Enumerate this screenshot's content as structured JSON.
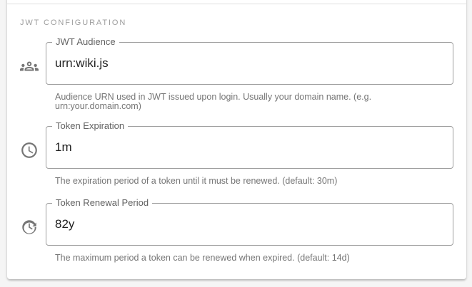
{
  "section": {
    "title": "JWT CONFIGURATION"
  },
  "fields": [
    {
      "icon": "people-icon",
      "label": "JWT Audience",
      "value": "urn:wiki.js",
      "hint": "Audience URN used in JWT issued upon login. Usually your domain name. (e.g. urn:your.domain.com)"
    },
    {
      "icon": "clock-icon",
      "label": "Token Expiration",
      "value": "1m",
      "hint": "The expiration period of a token until it must be renewed. (default: 30m)"
    },
    {
      "icon": "refresh-clock-icon",
      "label": "Token Renewal Period",
      "value": "82y",
      "hint": "The maximum period a token can be renewed when expired. (default: 14d)"
    }
  ]
}
